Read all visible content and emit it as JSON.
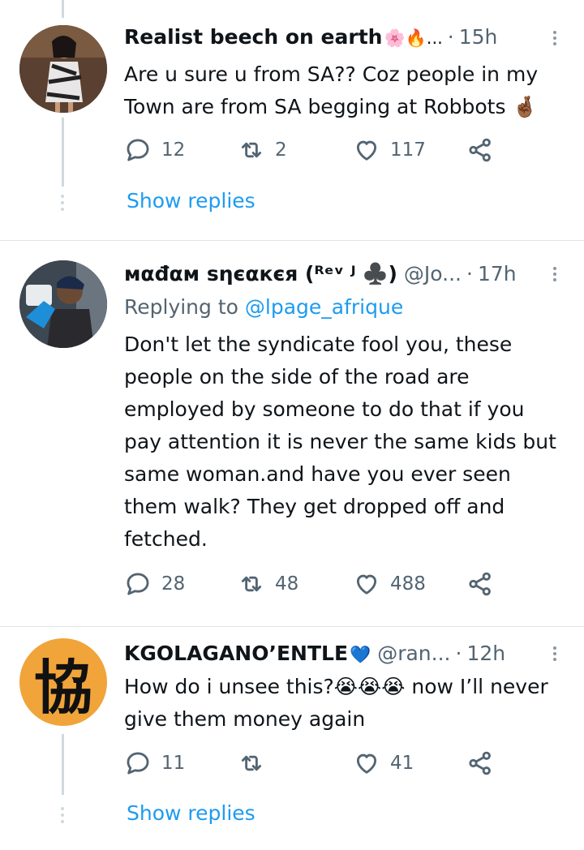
{
  "tweets": [
    {
      "name": "Realist beech on earth",
      "name_emojis": "🌸🔥...",
      "handle": "",
      "time": "15h",
      "replying_prefix": "",
      "replying_mention": "",
      "text": "Are u sure u from SA?? Coz people in my Town are from SA begging at Robbots 🤞🏾",
      "replies": "12",
      "retweets": "2",
      "likes": "117",
      "show_replies": "Show replies"
    },
    {
      "name": "мαđαм ѕηєαкєя (ᴿᵉᵛ ᴶ ♣️)",
      "name_emojis": "",
      "handle": "@Jo...",
      "time": "17h",
      "replying_prefix": "Replying to ",
      "replying_mention": "@lpage_afrique",
      "text": "Don't let the syndicate fool you, these people on the side of the road are employed by someone to do that if you pay attention it is never the same kids but same woman.and have you ever seen them walk? They get dropped off and fetched.",
      "replies": "28",
      "retweets": "48",
      "likes": "488",
      "show_replies": ""
    },
    {
      "name": "KGOLAGANO’ENTLE",
      "name_emojis": "💙",
      "handle": "@ran...",
      "time": "12h",
      "replying_prefix": "",
      "replying_mention": "",
      "text": "How do i unsee this?😭😭😭 now I’ll never give them money again",
      "replies": "11",
      "retweets": "",
      "likes": "41",
      "show_replies": "Show replies"
    }
  ],
  "avatar3_glyph": "協",
  "colors": {
    "link": "#1d9bf0",
    "secondary": "#536471",
    "avatar3_bg": "#f0a43a"
  },
  "icons": {
    "reply": "reply-icon",
    "retweet": "retweet-icon",
    "like": "heart-icon",
    "share": "share-icon",
    "more": "more-icon"
  }
}
